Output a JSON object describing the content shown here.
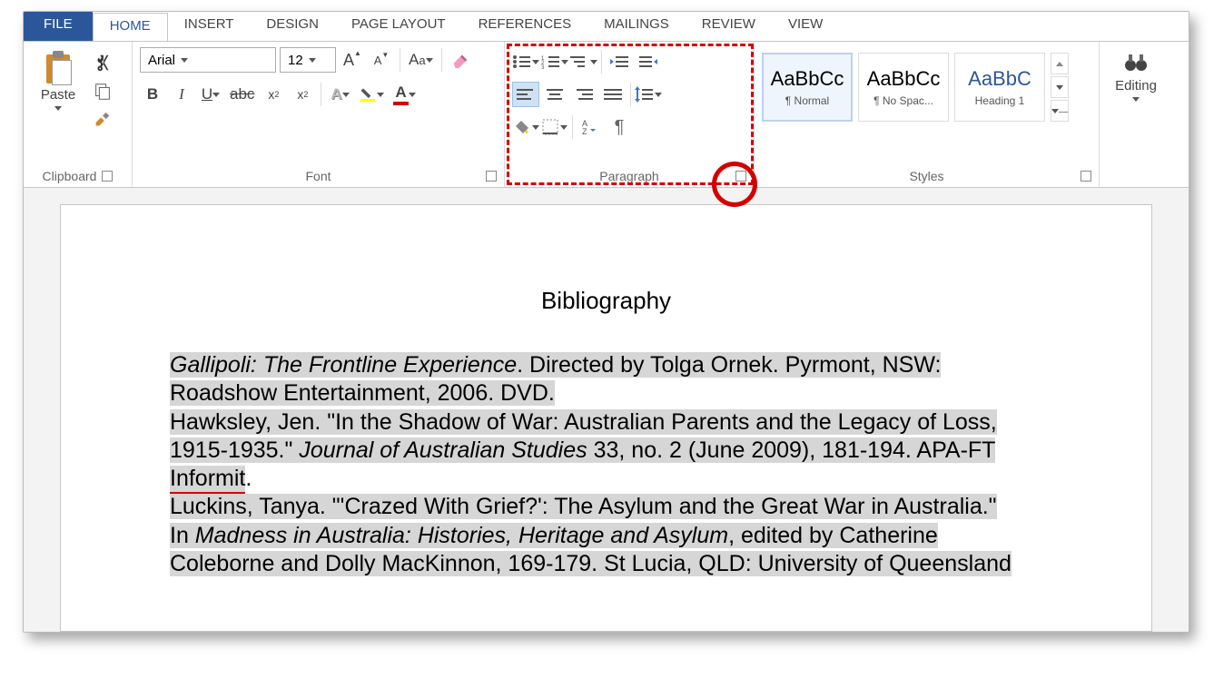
{
  "tabs": {
    "file": "FILE",
    "home": "HOME",
    "insert": "INSERT",
    "design": "DESIGN",
    "page_layout": "PAGE LAYOUT",
    "references": "REFERENCES",
    "mailings": "MAILINGS",
    "review": "REVIEW",
    "view": "VIEW"
  },
  "clipboard": {
    "paste": "Paste",
    "label": "Clipboard"
  },
  "font": {
    "name": "Arial",
    "size": "12",
    "label": "Font",
    "bold": "B",
    "italic": "I",
    "underline": "U",
    "strike": "abc",
    "sub": "x",
    "sub_small": "2",
    "sup": "x",
    "sup_small": "2",
    "caseA": "A",
    "casea": "a",
    "fx": "A"
  },
  "paragraph": {
    "label": "Paragraph"
  },
  "styles": {
    "label": "Styles",
    "s1_prev": "AaBbCc",
    "s1_name": "¶ Normal",
    "s2_prev": "AaBbCc",
    "s2_name": "¶ No Spac...",
    "s3_prev": "AaBbC",
    "s3_name": "Heading 1"
  },
  "editing": {
    "label": "Editing"
  },
  "document": {
    "title": "Bibliography",
    "e1a": "Gallipoli: The Frontline Experience",
    "e1b": ". Directed by Tolga Ornek. Pyrmont, NSW: ",
    "e1c": "Roadshow Entertainment, 2006. DVD.",
    "e2a": "Hawksley, Jen. \"In the Shadow of War: Australian Parents and the Legacy of Loss, ",
    "e2b": "1915-1935.\" ",
    "e2c": "Journal of Australian Studies",
    "e2d": " 33, no. 2 (June 2009), 181-194. APA-FT ",
    "e2e": "Informit",
    "e2f": ".",
    "e3a": "Luckins, Tanya. \"'Crazed With Grief?': The Asylum and the Great War in Australia.\" ",
    "e3b": "In ",
    "e3c": "Madness in Australia: Histories, Heritage and Asylum",
    "e3d": ", edited by Catherine ",
    "e3e": "Coleborne and Dolly MacKinnon, 169-179. St Lucia, QLD: University of Queensland"
  }
}
